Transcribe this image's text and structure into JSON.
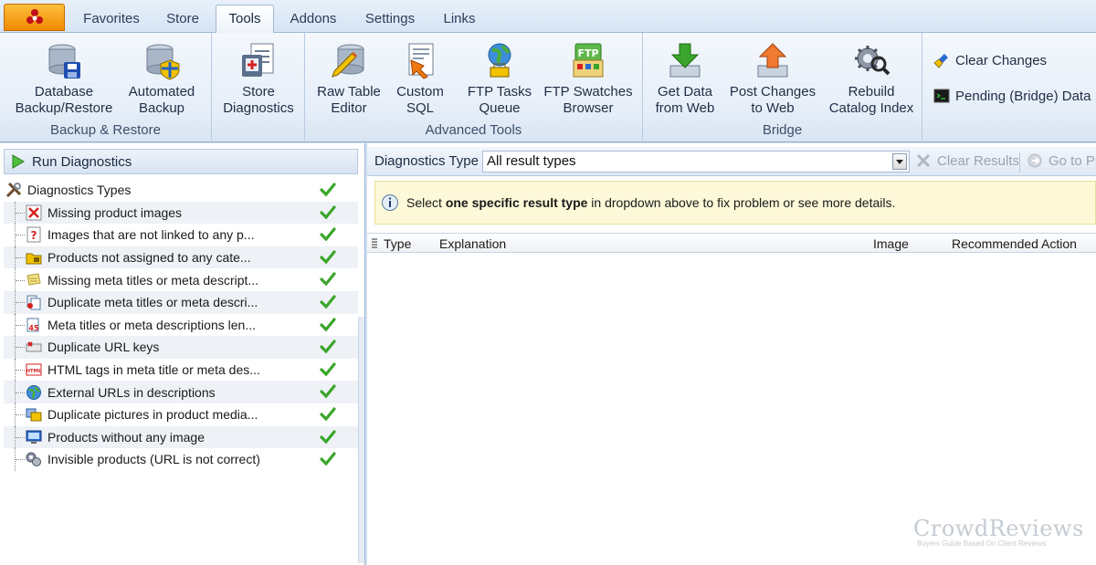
{
  "tabs": [
    "Favorites",
    "Store",
    "Tools",
    "Addons",
    "Settings",
    "Links"
  ],
  "active_tab": "Tools",
  "ribbon": {
    "groups": [
      {
        "label": "Backup & Restore",
        "buttons": [
          {
            "label": "Database\nBackup/Restore",
            "icon": "database-save-icon"
          },
          {
            "label": "Automated\nBackup",
            "icon": "database-shield-icon"
          }
        ]
      },
      {
        "label": "",
        "buttons": [
          {
            "label": "Store\nDiagnostics",
            "icon": "diagnostics-clipboard-icon"
          }
        ]
      },
      {
        "label": "Advanced Tools",
        "buttons": [
          {
            "label": "Raw Table\nEditor",
            "icon": "database-pencil-icon"
          },
          {
            "label": "Custom\nSQL",
            "icon": "sql-script-icon"
          },
          {
            "label": "FTP Tasks\nQueue",
            "icon": "globe-queue-icon"
          },
          {
            "label": "FTP Swatches\nBrowser",
            "icon": "ftp-folder-icon"
          }
        ]
      },
      {
        "label": "Bridge",
        "buttons": [
          {
            "label": "Get Data\nfrom Web",
            "icon": "download-arrow-icon"
          },
          {
            "label": "Post Changes\nto Web",
            "icon": "upload-arrow-icon"
          },
          {
            "label": "Rebuild\nCatalog Index",
            "icon": "gear-search-icon"
          }
        ]
      }
    ],
    "small_buttons": [
      {
        "label": "Clear Changes",
        "icon": "broom-icon"
      },
      {
        "label": "Pending (Bridge) Data",
        "icon": "terminal-icon"
      }
    ]
  },
  "left_panel": {
    "run_label": "Run Diagnostics",
    "root": "Diagnostics Types",
    "items": [
      "Missing product images",
      "Images that are not linked to any p...",
      "Products not assigned to any cate...",
      "Missing meta titles or meta descript...",
      "Duplicate meta titles or meta descri...",
      "Meta titles or meta descriptions len...",
      "Duplicate URL keys",
      "HTML tags in meta title or meta des...",
      "External URLs in descriptions",
      "Duplicate pictures in product media...",
      "Products without any image",
      "Invisible products (URL is not correct)"
    ]
  },
  "right_panel": {
    "type_label": "Diagnostics Type",
    "type_value": "All result types",
    "clear_results": "Clear Results",
    "go_to": "Go to Pr",
    "info": {
      "pre": "Select ",
      "bold": "one specific result type",
      "post": " in dropdown above to fix problem or see more details."
    },
    "columns": [
      "Type",
      "Explanation",
      "Image",
      "Recommended Action"
    ]
  },
  "watermark": {
    "title": "CrowdReviews",
    "subtitle": "Buyers Guide Based On Client Reviews"
  },
  "colors": {
    "accent": "#f08a00",
    "ribbon": "#e6eef8",
    "check": "#3aa52a",
    "info_bg": "#fcf8d8"
  }
}
